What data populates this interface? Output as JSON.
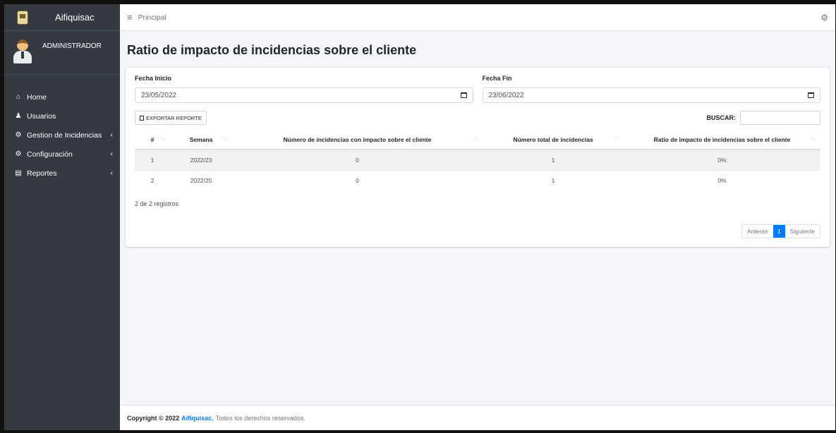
{
  "brand": {
    "name": "Aifiquisac"
  },
  "user": {
    "name": "ADMINISTRADOR"
  },
  "sidebar": {
    "items": [
      {
        "label": "Home",
        "icon": "home-icon",
        "has_children": false
      },
      {
        "label": "Usuarios",
        "icon": "users-icon",
        "has_children": false
      },
      {
        "label": "Gestion de Incidencias",
        "icon": "cogs-icon",
        "has_children": true
      },
      {
        "label": "Configuración",
        "icon": "cogs-icon",
        "has_children": true
      },
      {
        "label": "Reportes",
        "icon": "chart-icon",
        "has_children": true
      }
    ]
  },
  "topbar": {
    "breadcrumb": "Principal"
  },
  "page": {
    "title": "Ratio de impacto de incidencias sobre el cliente"
  },
  "filters": {
    "start_label": "Fecha Inicio",
    "start_value": "23/05/2022",
    "end_label": "Fecha Fin",
    "end_value": "23/06/2022"
  },
  "toolbar": {
    "export_label": "EXPORTAR REPORTE",
    "search_label": "BUSCAR:",
    "search_value": ""
  },
  "table": {
    "headers": [
      "#",
      "Semana",
      "Número de incidencias con impacto sobre el cliente",
      "Número total de incidencias",
      "Ratio de impacto de incidencias sobre el cliente"
    ],
    "rows": [
      [
        "1",
        "2022/23",
        "0",
        "1",
        "0%"
      ],
      [
        "2",
        "2022/25",
        "0",
        "1",
        "0%"
      ]
    ],
    "info": "2 de 2 registros"
  },
  "pagination": {
    "prev": "Anterior",
    "current": "1",
    "next": "Siguiente"
  },
  "footer": {
    "copyright": "Copyright © 2022",
    "brand": "Aifiquisac.",
    "rest": "Todos los derechos reservados."
  },
  "colors": {
    "sidebar": "#343a40",
    "accent": "#007bff",
    "background": "#f4f6f9"
  }
}
